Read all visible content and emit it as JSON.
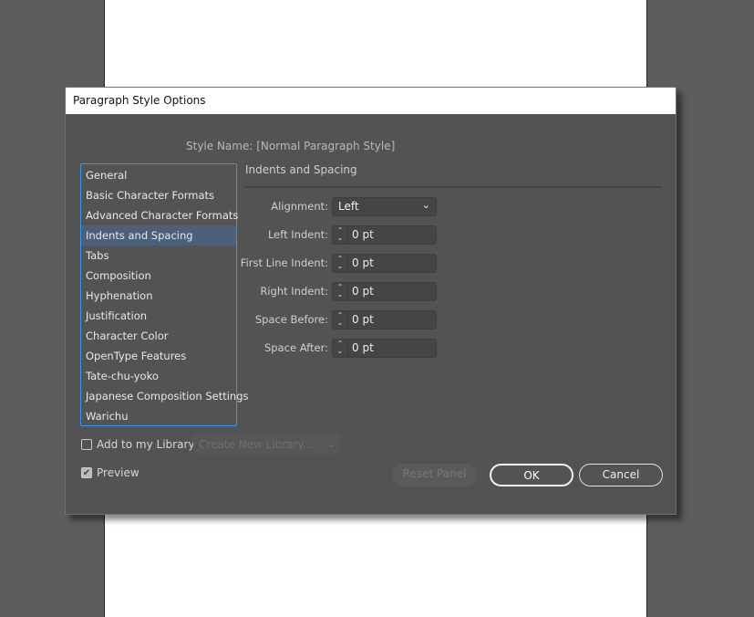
{
  "dialog": {
    "title": "Paragraph Style Options",
    "style_name_label": "Style Name:",
    "style_name_value": "[Normal Paragraph Style]"
  },
  "sidebar": {
    "items": [
      {
        "label": "General"
      },
      {
        "label": "Basic Character Formats"
      },
      {
        "label": "Advanced Character Formats"
      },
      {
        "label": "Indents and Spacing",
        "selected": true
      },
      {
        "label": "Tabs"
      },
      {
        "label": "Composition"
      },
      {
        "label": "Hyphenation"
      },
      {
        "label": "Justification"
      },
      {
        "label": "Character Color"
      },
      {
        "label": "OpenType Features"
      },
      {
        "label": "Tate-chu-yoko"
      },
      {
        "label": "Japanese Composition Settings"
      },
      {
        "label": "Warichu"
      }
    ]
  },
  "section": {
    "title": "Indents and Spacing",
    "alignment": {
      "label": "Alignment:",
      "value": "Left"
    },
    "fields": [
      {
        "label": "Left Indent:",
        "value": "0 pt"
      },
      {
        "label": "First Line Indent:",
        "value": "0 pt"
      },
      {
        "label": "Right Indent:",
        "value": "0 pt"
      },
      {
        "label": "Space Before:",
        "value": "0 pt"
      },
      {
        "label": "Space After:",
        "value": "0 pt"
      }
    ]
  },
  "footer": {
    "add_library_label": "Add to my Library",
    "add_library_checked": false,
    "library_placeholder": "Create New Library...",
    "preview_label": "Preview",
    "preview_checked": true,
    "reset": "Reset Panel",
    "ok": "OK",
    "cancel": "Cancel"
  }
}
